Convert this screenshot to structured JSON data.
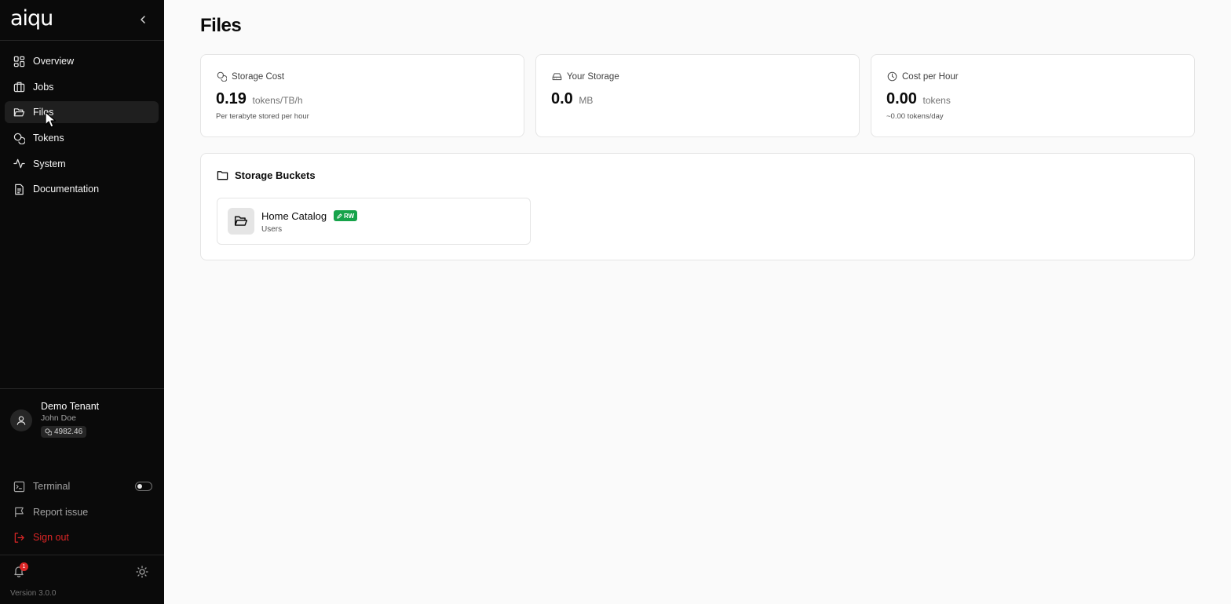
{
  "sidebar": {
    "logo": "aiqu",
    "nav": [
      {
        "label": "Overview",
        "icon": "grid-icon"
      },
      {
        "label": "Jobs",
        "icon": "briefcase-icon"
      },
      {
        "label": "Files",
        "icon": "folder-open-icon",
        "active": true
      },
      {
        "label": "Tokens",
        "icon": "coins-icon"
      },
      {
        "label": "System",
        "icon": "activity-icon"
      },
      {
        "label": "Documentation",
        "icon": "document-icon"
      }
    ],
    "user": {
      "tenant": "Demo Tenant",
      "name": "John Doe",
      "balance": "4982.46"
    },
    "bottom": {
      "terminal": "Terminal",
      "terminal_enabled": false,
      "report": "Report issue",
      "signout": "Sign out"
    },
    "notifications_count": "1",
    "version": "Version 3.0.0"
  },
  "main": {
    "title": "Files",
    "stats": [
      {
        "label": "Storage Cost",
        "value": "0.19",
        "unit": "tokens/TB/h",
        "sub": "Per terabyte stored per hour"
      },
      {
        "label": "Your Storage",
        "value": "0.0",
        "unit": "MB",
        "sub": ""
      },
      {
        "label": "Cost per Hour",
        "value": "0.00",
        "unit": "tokens",
        "sub": "~0.00 tokens/day"
      }
    ],
    "buckets": {
      "title": "Storage Buckets",
      "items": [
        {
          "name": "Home Catalog",
          "badge": "RW",
          "owner": "Users"
        }
      ]
    }
  },
  "colors": {
    "sidebar_bg": "#0a0a0a",
    "page_bg": "#fafafa",
    "badge_green": "#16a34a",
    "danger": "#dc2626"
  }
}
